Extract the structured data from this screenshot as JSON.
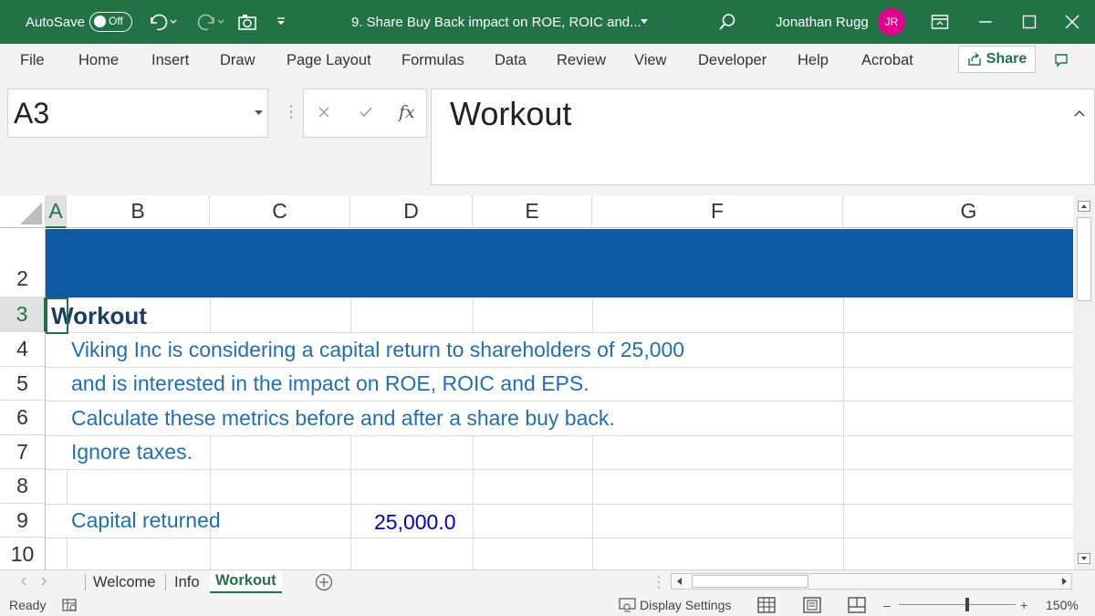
{
  "titlebar": {
    "autosave_label": "AutoSave",
    "autosave_state": "Off",
    "document_title": "9. Share Buy Back impact on ROE, ROIC and...",
    "user_name": "Jonathan Rugg",
    "user_initials": "JR",
    "accent_color": "#217346",
    "avatar_color": "#e3008c"
  },
  "ribbon": {
    "tabs": [
      "File",
      "Home",
      "Insert",
      "Draw",
      "Page Layout",
      "Formulas",
      "Data",
      "Review",
      "View",
      "Developer",
      "Help",
      "Acrobat"
    ],
    "share_label": "Share"
  },
  "formula_bar": {
    "name_box": "A3",
    "fx_label": "fx",
    "content": "Workout"
  },
  "grid": {
    "columns": [
      "A",
      "B",
      "C",
      "D",
      "E",
      "F",
      "G"
    ],
    "rows": [
      "2",
      "3",
      "4",
      "5",
      "6",
      "7",
      "8",
      "9",
      "10"
    ],
    "banner_color": "#0f59a4",
    "cells": {
      "a3": "Workout",
      "b4": "Viking Inc is considering a capital return to shareholders of 25,000",
      "b5": "and is interested in the impact on ROE, ROIC and EPS.",
      "b6": "Calculate these metrics before and after a share buy back.",
      "b7": "Ignore taxes.",
      "b9": "Capital returned",
      "d9": "25,000.0"
    }
  },
  "sheet_tabs": {
    "tabs": [
      "Welcome",
      "Info",
      "Workout"
    ],
    "active": "Workout"
  },
  "status_bar": {
    "mode": "Ready",
    "display_settings": "Display Settings",
    "zoom": "150%"
  }
}
